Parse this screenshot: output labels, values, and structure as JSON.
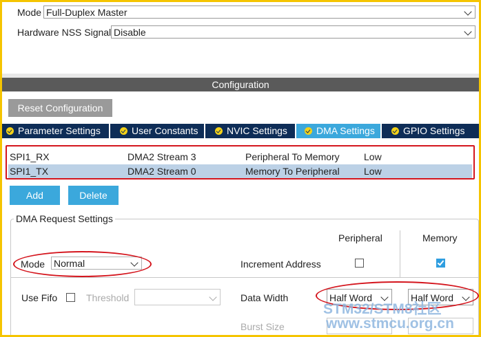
{
  "mode_field": {
    "label": "Mode",
    "value": "Full-Duplex Master"
  },
  "nss_field": {
    "label": "Hardware NSS Signal",
    "value": "Disable"
  },
  "configuration": {
    "title": "Configuration",
    "reset_label": "Reset Configuration"
  },
  "tabs": [
    {
      "label": "Parameter Settings",
      "active": false
    },
    {
      "label": "User Constants",
      "active": false
    },
    {
      "label": "NVIC Settings",
      "active": false
    },
    {
      "label": "DMA Settings",
      "active": true
    },
    {
      "label": "GPIO Settings",
      "active": false
    }
  ],
  "dma_table": {
    "rows": [
      {
        "request": "SPI1_RX",
        "stream": "DMA2 Stream 3",
        "direction": "Peripheral To Memory",
        "priority": "Low",
        "selected": false
      },
      {
        "request": "SPI1_TX",
        "stream": "DMA2 Stream 0",
        "direction": "Memory To Peripheral",
        "priority": "Low",
        "selected": true
      }
    ]
  },
  "buttons": {
    "add": "Add",
    "delete": "Delete"
  },
  "request_settings": {
    "title": "DMA Request Settings",
    "col_peripheral": "Peripheral",
    "col_memory": "Memory",
    "mode_label": "Mode",
    "mode_value": "Normal",
    "increment_label": "Increment Address",
    "increment_peripheral": false,
    "increment_memory": true,
    "use_fifo_label": "Use Fifo",
    "use_fifo": false,
    "threshold_label": "Threshold",
    "threshold_value": "",
    "data_width_label": "Data Width",
    "data_width_peripheral": "Half Word",
    "data_width_memory": "Half Word",
    "burst_size_label": "Burst Size"
  },
  "watermark": {
    "line1": "STM32/STM8社区",
    "line2": "www.stmcu.org.cn"
  },
  "colors": {
    "tab_bar": "#0e2d57",
    "tab_active": "#3ba8dc",
    "highlight": "#d4141c",
    "selected_row": "#bcd1e6"
  }
}
